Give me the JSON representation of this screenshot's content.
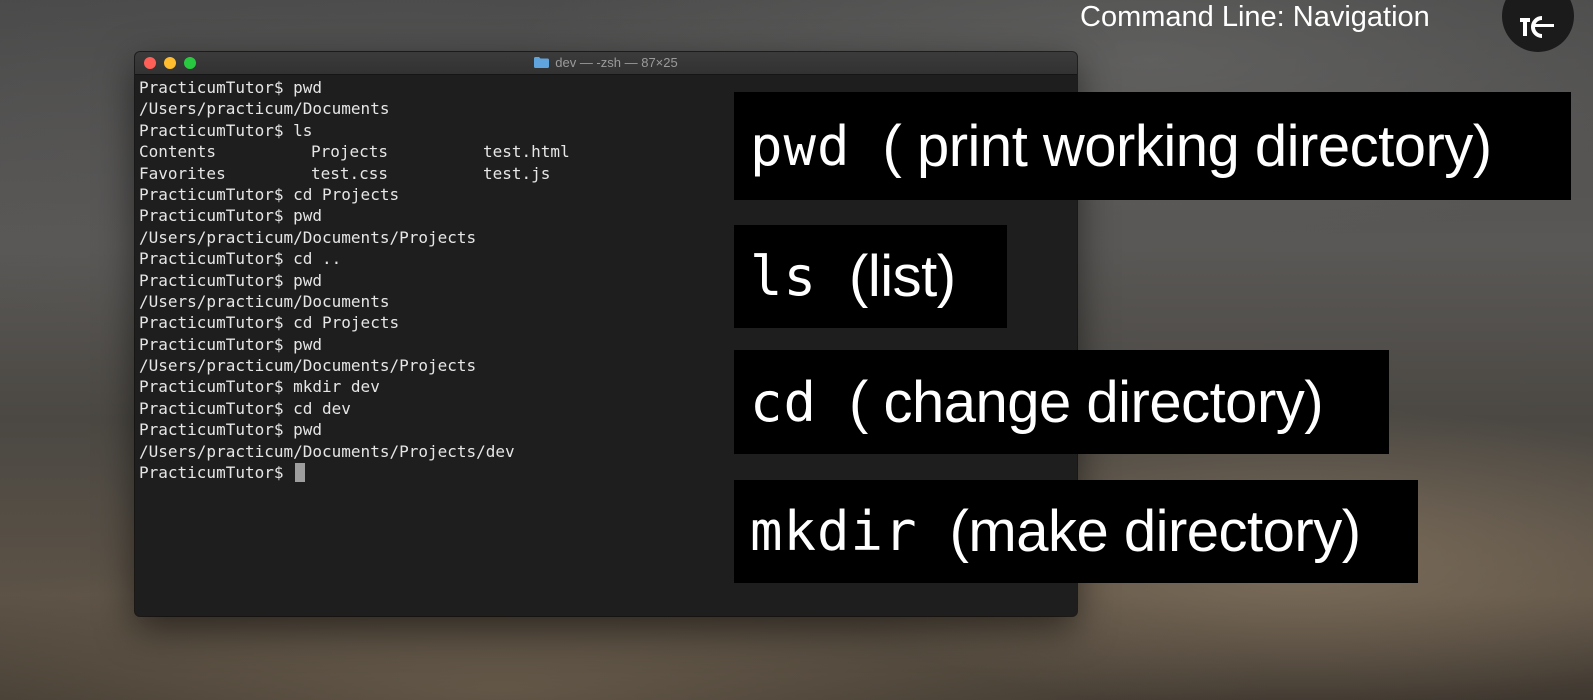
{
  "video": {
    "title": "Command Line: Navigation",
    "channel_icon": "channel-logo-icon"
  },
  "terminal": {
    "window_title": "dev — -zsh — 87×25",
    "title_icon": "folder-icon",
    "lines": [
      "PracticumTutor$ pwd",
      "/Users/practicum/Documents",
      "PracticumTutor$ ls"
    ],
    "ls_output": [
      [
        "Contents",
        "Projects",
        "test.html"
      ],
      [
        "Favorites",
        "test.css",
        "test.js"
      ]
    ],
    "lines_after": [
      "PracticumTutor$ cd Projects",
      "PracticumTutor$ pwd",
      "/Users/practicum/Documents/Projects",
      "PracticumTutor$ cd ..",
      "PracticumTutor$ pwd",
      "/Users/practicum/Documents",
      "PracticumTutor$ cd Projects",
      "PracticumTutor$ pwd",
      "/Users/practicum/Documents/Projects",
      "PracticumTutor$ mkdir dev",
      "PracticumTutor$ cd dev",
      "PracticumTutor$ pwd",
      "/Users/practicum/Documents/Projects/dev"
    ],
    "prompt": "PracticumTutor$ "
  },
  "captions": {
    "pwd": {
      "command": "pwd",
      "description": "( print working directory)"
    },
    "ls": {
      "command": "ls",
      "description": "(list)"
    },
    "cd": {
      "command": "cd",
      "description": "( change directory)"
    },
    "mkdir": {
      "command": "mkdir",
      "description": "(make directory)"
    }
  }
}
